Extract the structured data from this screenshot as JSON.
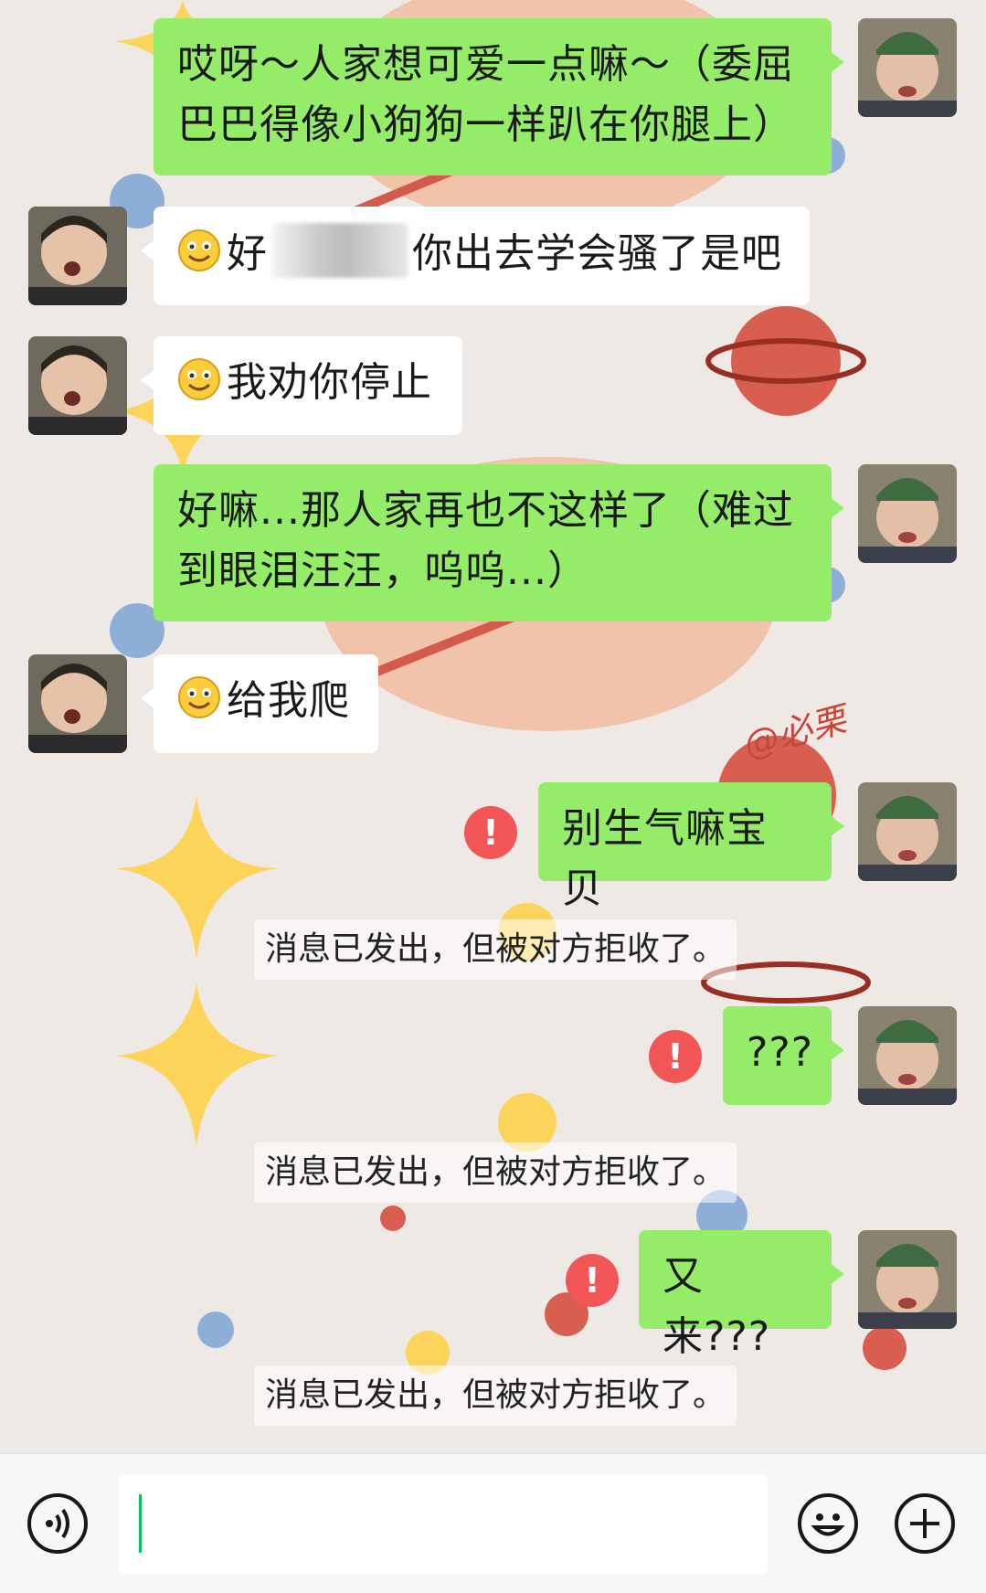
{
  "messages": [
    {
      "side": "me",
      "text": "哎呀～人家想可爱一点嘛～（委屈巴巴得像小狗狗一样趴在你腿上）"
    },
    {
      "side": "them",
      "emoji": "smile-emoji",
      "text_before": "好",
      "text_after": "你出去学会骚了是吧"
    },
    {
      "side": "them",
      "emoji": "smile-emoji",
      "text": "我劝你停止"
    },
    {
      "side": "me",
      "text": "好嘛...那人家再也不这样了（难过到眼泪汪汪，呜呜...）"
    },
    {
      "side": "them",
      "emoji": "smile-emoji",
      "text": "给我爬"
    },
    {
      "side": "me",
      "text": "别生气嘛宝贝",
      "failed": true
    },
    {
      "side": "me",
      "text": "???",
      "failed": true
    },
    {
      "side": "me",
      "text": "又来???",
      "failed": true
    }
  ],
  "system_notices": [
    "消息已发出，但被对方拒收了。",
    "消息已发出，但被对方拒收了。",
    "消息已发出，但被对方拒收了。"
  ],
  "error_mark": "!",
  "wallpaper_watermark": "@必栗",
  "colors": {
    "my_bubble": "#95ec69",
    "their_bubble": "#ffffff",
    "error": "#f25656",
    "caret": "#07c160",
    "background": "#efe9e6"
  },
  "input_bar": {
    "voice_icon": "voice-icon",
    "emoji_icon": "emoji-icon",
    "more_icon": "plus-icon",
    "value": ""
  }
}
